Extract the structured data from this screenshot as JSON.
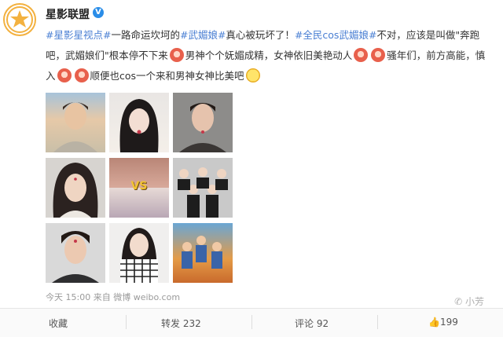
{
  "account": {
    "name": "星影联盟"
  },
  "post": {
    "tag1": "#星影星视点#",
    "t1": "一路命运坎坷的",
    "tag2": "#武媚娘#",
    "t2": "真心被玩坏了！",
    "tag3": "#全民cos武媚娘#",
    "t3": "不对，应该是叫做\"奔跑吧，武媚娘们\"根本停不下来",
    "t4": "男神个个妩媚成精，女神依旧美艳动人",
    "t5": "骚年们，前方高能，慎入",
    "t6": "顺便也cos一个来和男神女神比美吧"
  },
  "vs_text": "VS",
  "meta": {
    "time": "今天 15:00",
    "source_prefix": "来自",
    "source": "微博 weibo.com"
  },
  "watermark": "小芳",
  "actions": {
    "collect": "收藏",
    "repost": "转发 232",
    "comment": "评论 92",
    "like": "199"
  }
}
